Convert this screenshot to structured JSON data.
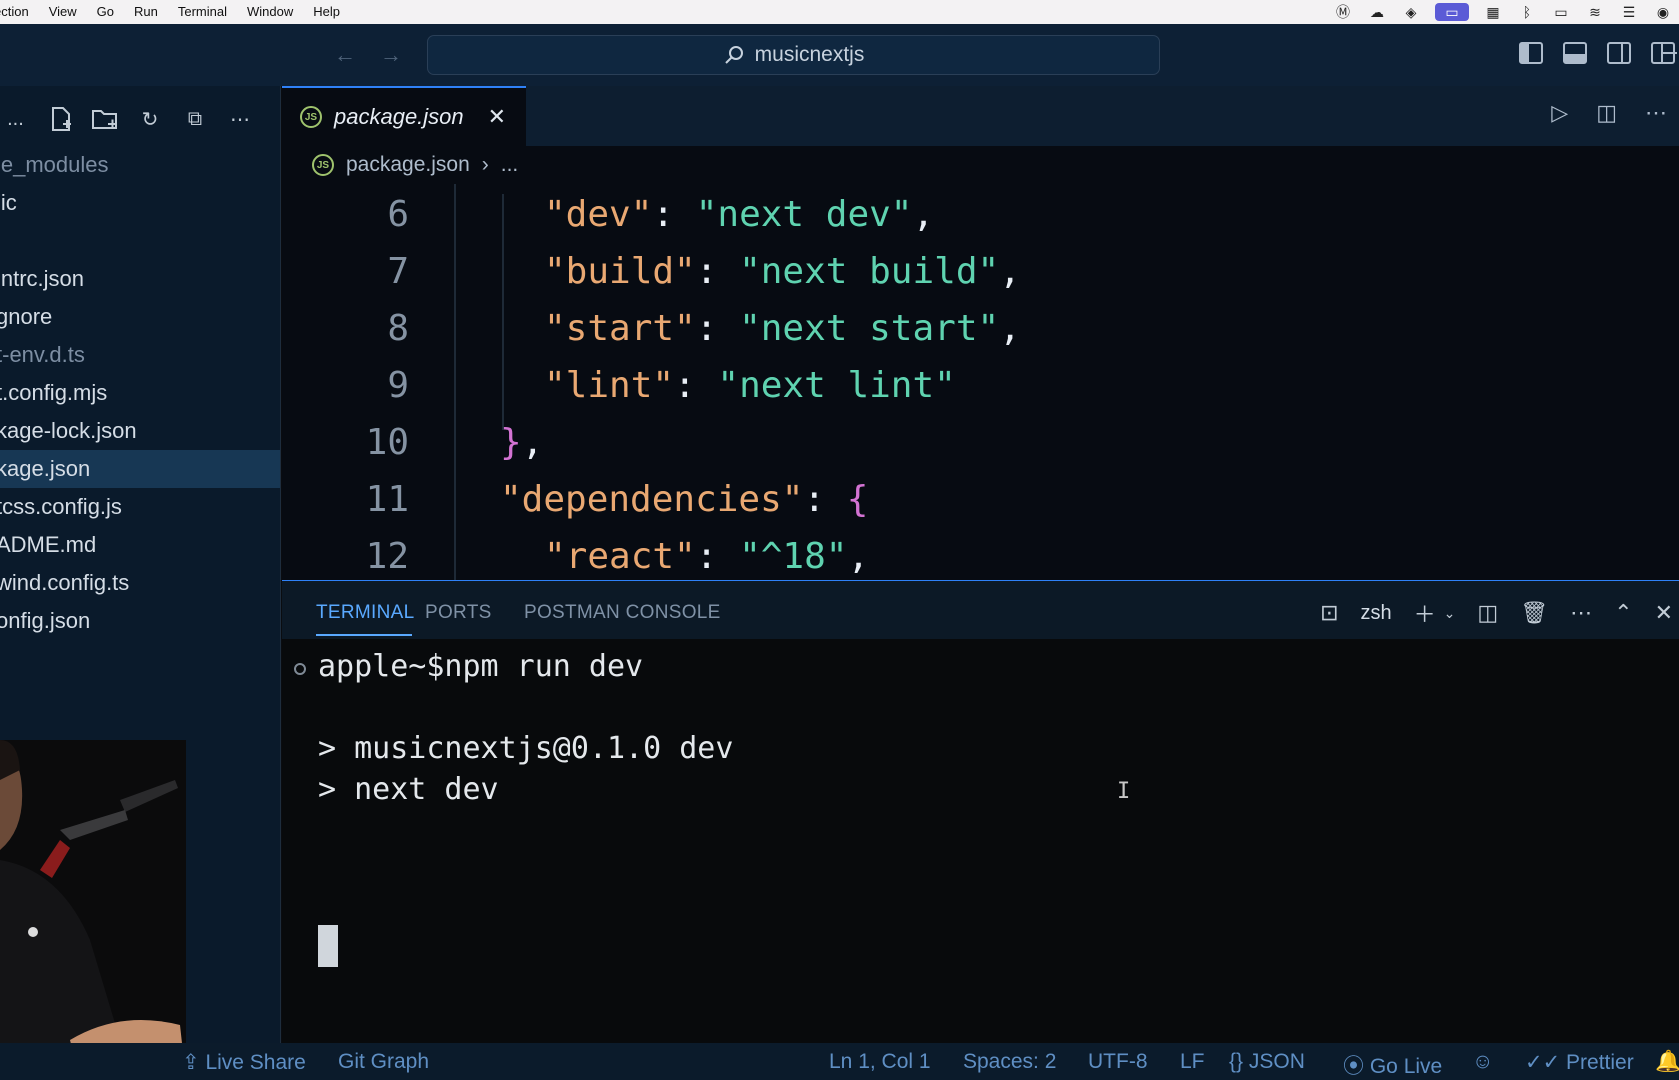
{
  "menubar": {
    "items": [
      "ection",
      "View",
      "Go",
      "Run",
      "Terminal",
      "Window",
      "Help"
    ]
  },
  "titlebar": {
    "search_text": "musicnextjs"
  },
  "sidebar": {
    "header_text": ": ...",
    "files": [
      {
        "name": "le_modules",
        "style": "dim"
      },
      {
        "name": "lic",
        "style": "normal"
      },
      {
        "name": "",
        "style": "gap"
      },
      {
        "name": "intrc.json",
        "style": "normal"
      },
      {
        "name": "gnore",
        "style": "normal"
      },
      {
        "name": "t-env.d.ts",
        "style": "dim"
      },
      {
        "name": "t.config.mjs",
        "style": "normal"
      },
      {
        "name": "kage-lock.json",
        "style": "normal"
      },
      {
        "name": "kage.json",
        "style": "active"
      },
      {
        "name": "tcss.config.js",
        "style": "normal"
      },
      {
        "name": "ADME.md",
        "style": "normal"
      },
      {
        "name": "wind.config.ts",
        "style": "normal"
      },
      {
        "name": "onfig.json",
        "style": "normal"
      }
    ]
  },
  "editor": {
    "tab_label": "package.json",
    "breadcrumb_file": "package.json",
    "breadcrumb_rest": "...",
    "lines": [
      {
        "num": "6",
        "key": "\"dev\"",
        "value": "\"next dev\"",
        "trail": ","
      },
      {
        "num": "7",
        "key": "\"build\"",
        "value": "\"next build\"",
        "trail": ","
      },
      {
        "num": "8",
        "key": "\"start\"",
        "value": "\"next start\"",
        "trail": ","
      },
      {
        "num": "9",
        "key": "\"lint\"",
        "value": "\"next lint\"",
        "trail": ""
      },
      {
        "num": "10",
        "close": "}",
        "trail": ","
      },
      {
        "num": "11",
        "key": "\"dependencies\"",
        "open": "{"
      },
      {
        "num": "12",
        "key": "\"react\"",
        "value": "\"^18\"",
        "trail": ","
      }
    ]
  },
  "panel": {
    "tabs": [
      "TERMINAL",
      "PORTS",
      "POSTMAN CONSOLE"
    ],
    "active_tab": "TERMINAL",
    "shell": "zsh",
    "terminal_lines": [
      "apple~$npm run dev",
      "",
      "> musicnextjs@0.1.0 dev",
      "> next dev"
    ]
  },
  "statusbar": {
    "live_share": "Live Share",
    "git_graph": "Git Graph",
    "position": "Ln 1, Col 1",
    "spaces": "Spaces: 2",
    "encoding": "UTF-8",
    "eol": "LF",
    "language": "JSON",
    "go_live": "Go Live",
    "prettier": "Prettier"
  },
  "colors": {
    "accent": "#2f81f7",
    "json_key": "#e9a872",
    "json_string": "#5fd3b0",
    "brace": "#d373d3"
  }
}
